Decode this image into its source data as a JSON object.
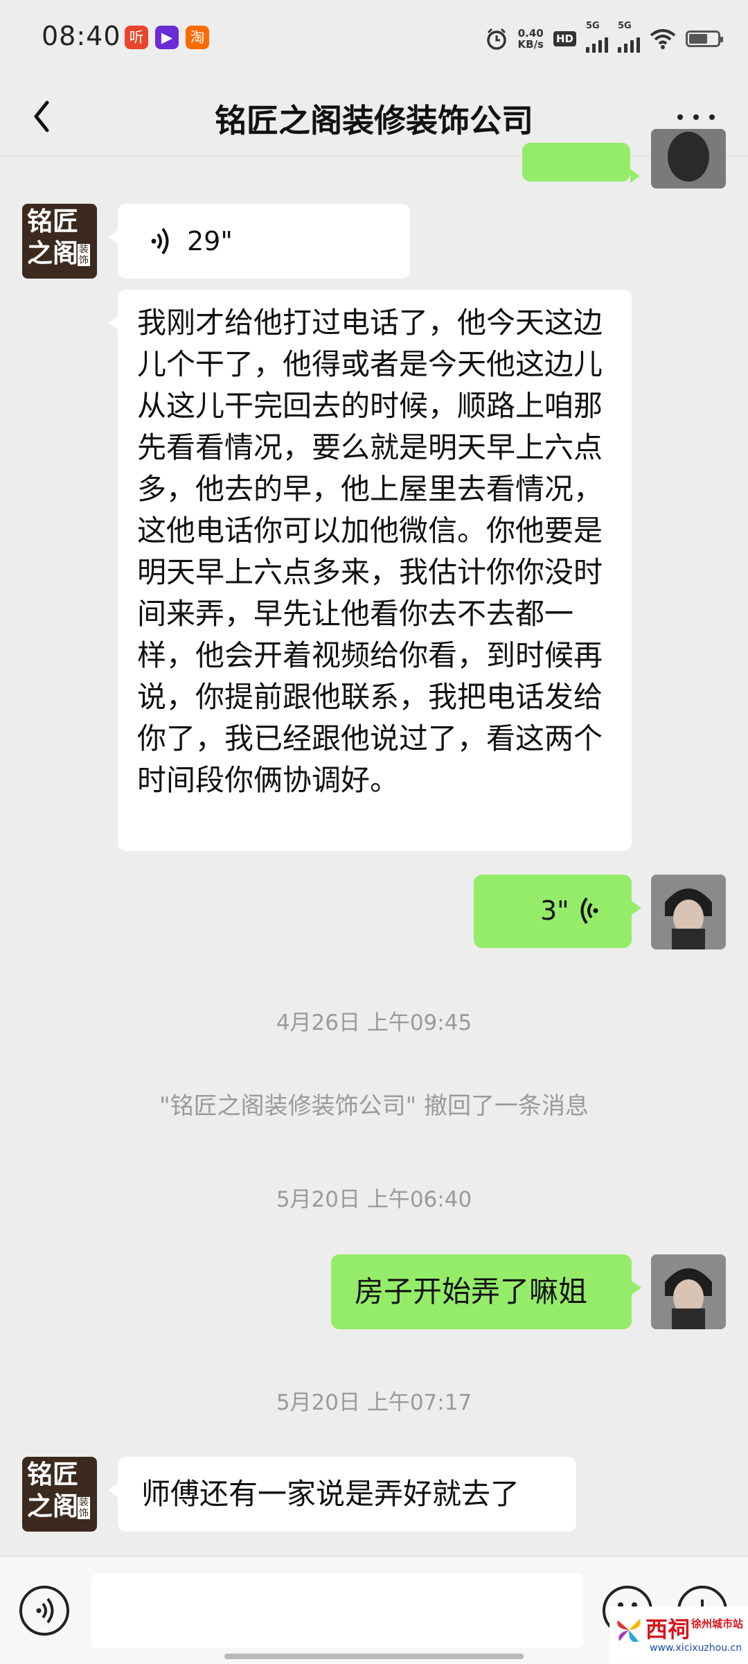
{
  "status_bar": {
    "time": "08:40",
    "badges": [
      {
        "icon": "ting-app-icon",
        "label": "听",
        "color": "#e8452c"
      },
      {
        "icon": "video-app-icon",
        "label": "▶",
        "color": "#6b2bd6"
      },
      {
        "icon": "taobao-app-icon",
        "label": "淘",
        "color": "#ff6a00"
      }
    ],
    "net_speed_value": "0.40",
    "net_speed_unit": "KB/s",
    "hd_label": "HD",
    "sim1_label": "5G",
    "sim2_label": "5G",
    "battery_level": 0.65
  },
  "header": {
    "title": "铭匠之阁装修装饰公司"
  },
  "contact_logo": {
    "line1": "铭匠",
    "line2": "之阁",
    "tag": "装饰"
  },
  "messages": {
    "voice_in": {
      "duration": "29\""
    },
    "long_text": "我刚才给他打过电话了，他今天这边儿个干了，他得或者是今天他这边儿从这儿干完回去的时候，顺路上咱那先看看情况，要么就是明天早上六点多，他去的早，他上屋里去看情况，这他电话你可以加他微信。你他要是明天早上六点多来，我估计你你没时间来弄，早先让他看你去不去都一样，他会开着视频给你看，到时候再说，你提前跟他联系，我把电话发给你了，我已经跟他说过了，看这两个时间段你俩协调好。",
    "voice_out": {
      "duration": "3\""
    },
    "time1": "4月26日 上午09:45",
    "recall_notice": "\"铭匠之阁装修装饰公司\" 撤回了一条消息",
    "time2": "5月20日 上午06:40",
    "out_text": "房子开始弄了嘛姐",
    "time3": "5月20日 上午07:17",
    "in_text2": "师傅还有一家说是弄好就去了"
  },
  "input": {
    "value": ""
  },
  "watermark": {
    "brand": "西祠",
    "city": "徐州城市站",
    "url": "www.xicixuzhou.cn"
  },
  "colors": {
    "sent_bubble": "#95ec69",
    "received_bubble": "#ffffff",
    "background": "#ededed"
  }
}
